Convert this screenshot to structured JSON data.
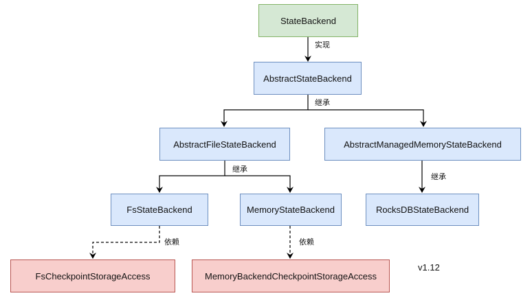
{
  "nodes": {
    "state_backend": "StateBackend",
    "abstract_state_backend": "AbstractStateBackend",
    "abstract_file_state_backend": "AbstractFileStateBackend",
    "abstract_managed_memory_state_backend": "AbstractManagedMemoryStateBackend",
    "fs_state_backend": "FsStateBackend",
    "memory_state_backend": "MemoryStateBackend",
    "rocksdb_state_backend": "RocksDBStateBackend",
    "fs_checkpoint_storage_access": "FsCheckpointStorageAccess",
    "memory_backend_checkpoint_storage_access": "MemoryBackendCheckpointStorageAccess"
  },
  "edges": {
    "implements": "实现",
    "inherits": "继承",
    "depends": "依赖"
  },
  "version": "v1.12",
  "colors": {
    "interface_fill": "#d5e8d4",
    "class_fill": "#dae8fc",
    "storage_fill": "#f8cecc"
  }
}
